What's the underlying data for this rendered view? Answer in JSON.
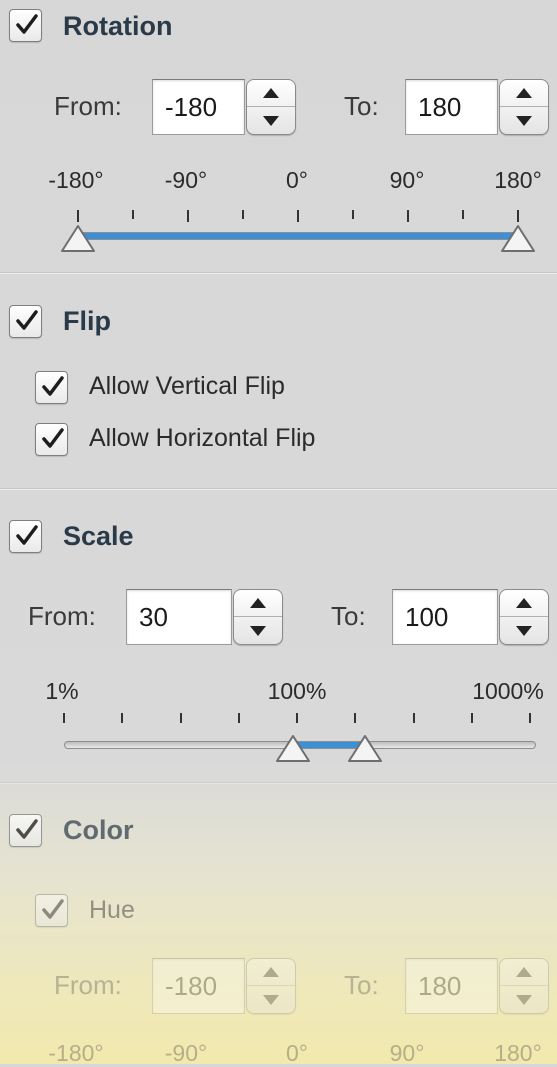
{
  "rotation": {
    "title": "Rotation",
    "checked": true,
    "from_label": "From:",
    "from_value": "-180",
    "to_label": "To:",
    "to_value": "180",
    "ticks": [
      "-180°",
      "-90°",
      "0°",
      "90°",
      "180°"
    ],
    "range_low_fraction": 0.0,
    "range_high_fraction": 1.0
  },
  "flip": {
    "title": "Flip",
    "checked": true,
    "vertical_label": "Allow Vertical Flip",
    "vertical_checked": true,
    "horizontal_label": "Allow Horizontal Flip",
    "horizontal_checked": true
  },
  "scale": {
    "title": "Scale",
    "checked": true,
    "from_label": "From:",
    "from_value": "30",
    "to_label": "To:",
    "to_value": "100",
    "ticks": [
      "1%",
      "100%",
      "1000%"
    ],
    "range_low_value": 30,
    "range_high_value": 100
  },
  "color": {
    "title": "Color",
    "checked": true,
    "hue_label": "Hue",
    "hue_checked": true,
    "from_label": "From:",
    "from_value": "-180",
    "to_label": "To:",
    "to_value": "180",
    "ticks": [
      "-180°",
      "-90°",
      "0°",
      "90°",
      "180°"
    ]
  },
  "colors": {
    "accent": "#3d8fd6",
    "section_title": "#2a3a48"
  },
  "icons": {
    "checkbox": "checkmark-icon",
    "stepper": "stepper-arrows-icon",
    "thumb": "slider-thumb-icon"
  }
}
